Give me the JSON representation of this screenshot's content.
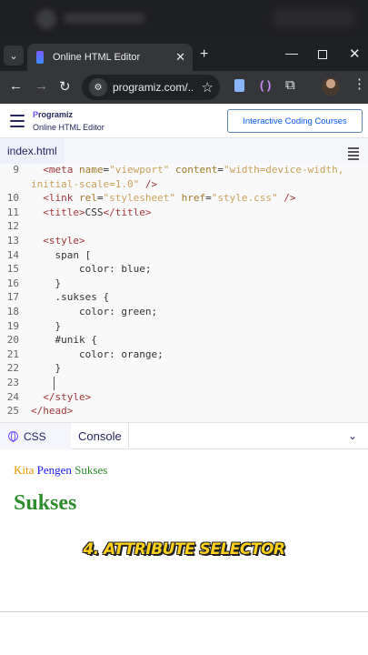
{
  "browser": {
    "tab_list_icon": "chevron-down-icon",
    "tab": {
      "title": "Online HTML Editor",
      "close": "✕"
    },
    "new_tab": "+",
    "window": {
      "minimize": "—",
      "close": "✕"
    },
    "toolbar": {
      "back": "←",
      "forward": "→",
      "reload": "↻",
      "url": "programiz.com/...",
      "star": "☆",
      "ext_bracket": "( )",
      "puzzle": "⧉",
      "more": "⋮"
    }
  },
  "site": {
    "logo": "Programiz",
    "logo_accent": "P",
    "logo_rest": "rogramiz",
    "subtitle": "Online HTML Editor",
    "cta": "Interactive Coding Courses"
  },
  "editor": {
    "file_tab": "index.html",
    "lines": [
      {
        "n": "9",
        "parts": [
          [
            "t",
            "  <meta "
          ],
          [
            "a",
            "name"
          ],
          [
            "p",
            "="
          ],
          [
            "s",
            "\"viewport\""
          ],
          [
            "p",
            " "
          ],
          [
            "a",
            "content"
          ],
          [
            "p",
            "="
          ],
          [
            "s",
            "\"width=device-width,"
          ]
        ]
      },
      {
        "n": "",
        "parts": [
          [
            "s",
            "initial-scale=1.0\""
          ],
          [
            "p",
            " "
          ],
          [
            "t",
            "/>"
          ]
        ]
      },
      {
        "n": "10",
        "parts": [
          [
            "t",
            "  <link "
          ],
          [
            "a",
            "rel"
          ],
          [
            "p",
            "="
          ],
          [
            "s",
            "\"stylesheet\""
          ],
          [
            "p",
            " "
          ],
          [
            "a",
            "href"
          ],
          [
            "p",
            "="
          ],
          [
            "s",
            "\"style.css\""
          ],
          [
            "p",
            " "
          ],
          [
            "t",
            "/>"
          ]
        ]
      },
      {
        "n": "11",
        "parts": [
          [
            "t",
            "  <title>"
          ],
          [
            "p",
            "CSS"
          ],
          [
            "t",
            "</title>"
          ]
        ]
      },
      {
        "n": "12",
        "parts": []
      },
      {
        "n": "13",
        "parts": [
          [
            "t",
            "  <style>"
          ]
        ]
      },
      {
        "n": "14",
        "parts": [
          [
            "p",
            "    span [ "
          ]
        ]
      },
      {
        "n": "15",
        "parts": [
          [
            "p",
            "        color: blue;"
          ]
        ]
      },
      {
        "n": "16",
        "parts": [
          [
            "p",
            "    }"
          ]
        ]
      },
      {
        "n": "17",
        "parts": [
          [
            "p",
            "    .sukses {"
          ]
        ]
      },
      {
        "n": "18",
        "parts": [
          [
            "p",
            "        color: green;"
          ]
        ]
      },
      {
        "n": "19",
        "parts": [
          [
            "p",
            "    }"
          ]
        ]
      },
      {
        "n": "20",
        "parts": [
          [
            "p",
            "    #unik {"
          ]
        ]
      },
      {
        "n": "21",
        "parts": [
          [
            "p",
            "        color: orange;"
          ]
        ]
      },
      {
        "n": "22",
        "parts": [
          [
            "p",
            "    }"
          ]
        ]
      },
      {
        "n": "23",
        "parts": []
      },
      {
        "n": "24",
        "parts": [
          [
            "t",
            "  </style>"
          ]
        ]
      },
      {
        "n": "25",
        "parts": [
          [
            "t",
            "</head>"
          ]
        ]
      }
    ]
  },
  "output": {
    "tab_css": "CSS",
    "tab_console": "Console",
    "chevron": "⌄",
    "preview_line": [
      {
        "text": "Kita ",
        "color": "#e69500"
      },
      {
        "text": "Pengen ",
        "color": "#1a1aff"
      },
      {
        "text": "Sukses",
        "color": "#2e8b2e"
      }
    ],
    "heading": "Sukses",
    "caption": "4. ATTRIBUTE SELECTOR"
  }
}
